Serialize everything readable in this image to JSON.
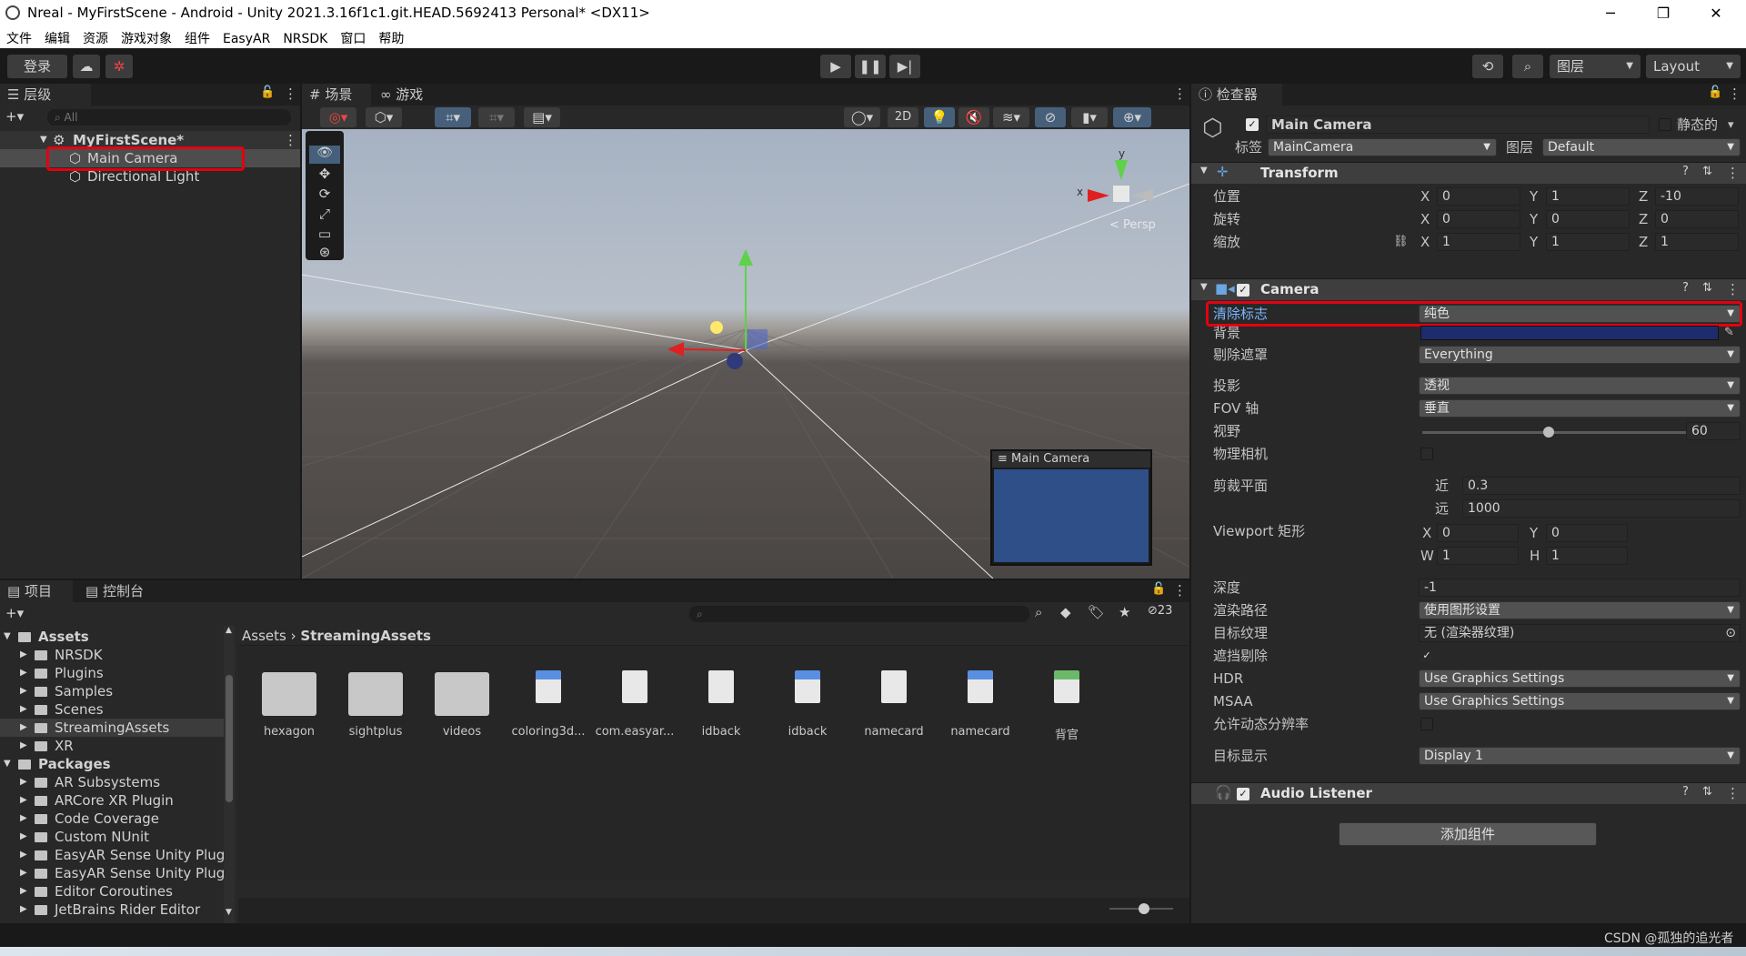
{
  "window": {
    "title": "Nreal - MyFirstScene - Android - Unity 2021.3.16f1c1.git.HEAD.5692413 Personal* <DX11>",
    "minimize": "─",
    "maximize": "❐",
    "close": "✕"
  },
  "menu": [
    "文件",
    "编辑",
    "资源",
    "游戏对象",
    "组件",
    "EasyAR",
    "NRSDK",
    "窗口",
    "帮助"
  ],
  "toolbar": {
    "login": "登录",
    "layers": "图层",
    "layout": "Layout"
  },
  "hierarchy": {
    "tab": "层级",
    "search_placeholder": "All",
    "scene": "MyFirstScene*",
    "items": [
      "Main Camera",
      "Directional Light"
    ]
  },
  "scene_view": {
    "tab_scene": "场景",
    "tab_game": "游戏",
    "mode_2d": "2D",
    "persp": "< Persp",
    "gizmo_y": "y",
    "gizmo_x": "x",
    "preview_title": "Main Camera"
  },
  "project": {
    "tab_project": "项目",
    "tab_console": "控制台",
    "hidden_count": "23",
    "tree": [
      {
        "label": "Assets",
        "level": 0,
        "bold": true
      },
      {
        "label": "NRSDK",
        "level": 1
      },
      {
        "label": "Plugins",
        "level": 1
      },
      {
        "label": "Samples",
        "level": 1
      },
      {
        "label": "Scenes",
        "level": 1
      },
      {
        "label": "StreamingAssets",
        "level": 1,
        "selected": true
      },
      {
        "label": "XR",
        "level": 1
      },
      {
        "label": "Packages",
        "level": 0,
        "bold": true
      },
      {
        "label": "AR Subsystems",
        "level": 1
      },
      {
        "label": "ARCore XR Plugin",
        "level": 1
      },
      {
        "label": "Code Coverage",
        "level": 1
      },
      {
        "label": "Custom NUnit",
        "level": 1
      },
      {
        "label": "EasyAR Sense Unity Plug",
        "level": 1
      },
      {
        "label": "EasyAR Sense Unity Plug",
        "level": 1
      },
      {
        "label": "Editor Coroutines",
        "level": 1
      },
      {
        "label": "JetBrains Rider Editor",
        "level": 1
      }
    ],
    "breadcrumb": [
      "Assets",
      "StreamingAssets"
    ],
    "assets": [
      {
        "label": "hexagon",
        "kind": "folder"
      },
      {
        "label": "sightplus",
        "kind": "folder"
      },
      {
        "label": "videos",
        "kind": "folder"
      },
      {
        "label": "coloring3d...",
        "kind": "image"
      },
      {
        "label": "com.easyar...",
        "kind": "file"
      },
      {
        "label": "idback",
        "kind": "file"
      },
      {
        "label": "idback",
        "kind": "image"
      },
      {
        "label": "namecard",
        "kind": "file"
      },
      {
        "label": "namecard",
        "kind": "image"
      },
      {
        "label": "背官",
        "kind": "green"
      }
    ]
  },
  "inspector": {
    "tab": "检查器",
    "object_name": "Main Camera",
    "static_label": "静态的",
    "tag_label": "标签",
    "tag_value": "MainCamera",
    "layer_label": "图层",
    "layer_value": "Default",
    "transform": {
      "title": "Transform",
      "rows": [
        {
          "label": "位置",
          "x": "0",
          "y": "1",
          "z": "-10"
        },
        {
          "label": "旋转",
          "x": "0",
          "y": "0",
          "z": "0"
        },
        {
          "label": "缩放",
          "x": "1",
          "y": "1",
          "z": "1"
        }
      ]
    },
    "camera": {
      "title": "Camera",
      "clear_flags_label": "清除标志",
      "clear_flags_value": "纯色",
      "background_label": "背景",
      "background_color": "#1e2c6e",
      "culling_label": "剔除遮罩",
      "culling_value": "Everything",
      "projection_label": "投影",
      "projection_value": "透视",
      "fov_axis_label": "FOV 轴",
      "fov_axis_value": "垂直",
      "fov_label": "视野",
      "fov_value": "60",
      "fov_fraction": 0.48,
      "physical_label": "物理相机",
      "clip_label": "剪裁平面",
      "near_label": "近",
      "near_value": "0.3",
      "far_label": "远",
      "far_value": "1000",
      "viewport_label": "Viewport 矩形",
      "vx": "0",
      "vy": "0",
      "vw": "1",
      "vh": "1",
      "depth_label": "深度",
      "depth_value": "-1",
      "render_path_label": "渲染路径",
      "render_path_value": "使用图形设置",
      "target_tex_label": "目标纹理",
      "target_tex_value": "无 (渲染器纹理)",
      "occlusion_label": "遮挡剔除",
      "hdr_label": "HDR",
      "hdr_value": "Use Graphics Settings",
      "msaa_label": "MSAA",
      "msaa_value": "Use Graphics Settings",
      "dynres_label": "允许动态分辨率",
      "target_display_label": "目标显示",
      "target_display_value": "Display 1"
    },
    "audio_listener": "Audio Listener",
    "add_component": "添加组件"
  },
  "status": {
    "watermark": "CSDN @孤独的追光者"
  },
  "axis_labels": {
    "x": "X",
    "y": "Y",
    "z": "Z",
    "w": "W",
    "h": "H"
  }
}
